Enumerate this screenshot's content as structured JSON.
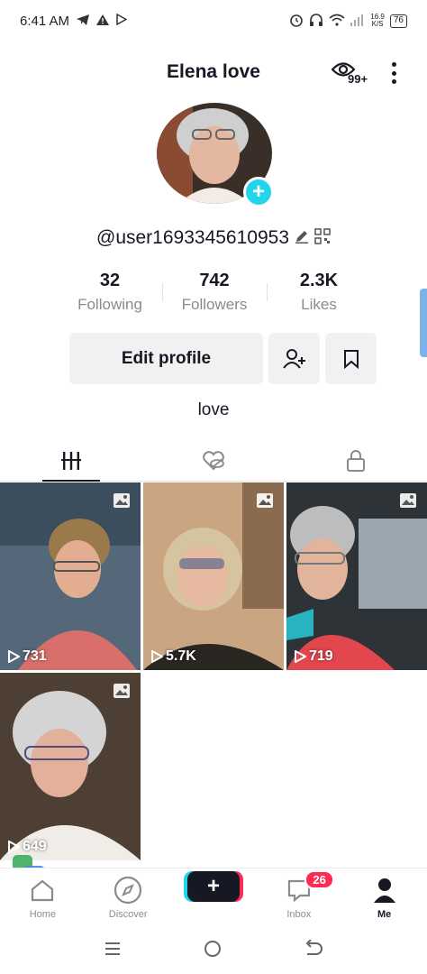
{
  "status_bar": {
    "time": "6:41 AM",
    "net_speed_value": "16.9",
    "net_speed_unit": "K/S",
    "battery": "76"
  },
  "header": {
    "name": "Elena love",
    "views_badge": "99+"
  },
  "profile": {
    "username": "@user1693345610953",
    "bio": "love"
  },
  "stats": [
    {
      "value": "32",
      "label": "Following"
    },
    {
      "value": "742",
      "label": "Followers"
    },
    {
      "value": "2.3K",
      "label": "Likes"
    }
  ],
  "buttons": {
    "edit_profile": "Edit profile"
  },
  "videos": [
    {
      "views": "731",
      "bg": "#6b7b8c"
    },
    {
      "views": "5.7K",
      "bg": "#b8926e"
    },
    {
      "views": "719",
      "bg": "#4f5a63"
    },
    {
      "views": "649",
      "bg": "#5a5048"
    }
  ],
  "bottom_nav": {
    "home": "Home",
    "discover": "Discover",
    "inbox": "Inbox",
    "inbox_badge": "26",
    "me": "Me"
  },
  "colors": {
    "accent_cyan": "#20d5ec",
    "accent_red": "#fe2c55",
    "text_primary": "#161823",
    "text_secondary": "#8a8b91"
  }
}
